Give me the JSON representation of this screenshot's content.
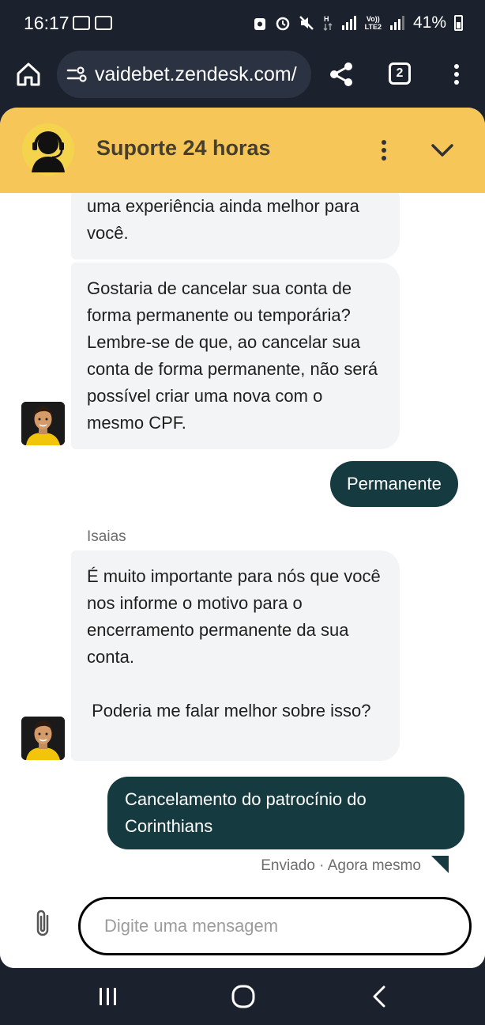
{
  "status_bar": {
    "time": "16:17",
    "notif_icons": [
      "ticket-icon",
      "ticket-icon"
    ],
    "right_icons": [
      "recycle-icon",
      "alarm-icon",
      "mute-icon",
      "hplus-data-icon",
      "signal-icon",
      "volte-lte2-icon",
      "signal-icon"
    ],
    "network_label_top": "Vo))",
    "network_label_bottom": "LTE2",
    "battery": "41%"
  },
  "browser": {
    "url": "vaidebet.zendesk.com/",
    "tab_count": "2",
    "icons": [
      "home-icon",
      "site-settings-icon",
      "share-icon",
      "tab-switcher-icon",
      "more-vert-icon"
    ]
  },
  "chat": {
    "header_title": "Suporte 24 horas",
    "header_color": "#f6c758",
    "agent_bubble_color": "#f3f4f6",
    "user_bubble_color": "#153a3f",
    "messages": [
      {
        "from": "agent",
        "text": "uma experiência ainda melhor para você."
      },
      {
        "from": "agent",
        "text": "Gostaria de cancelar sua conta de forma permanente ou temporária? Lembre-se de que, ao cancelar sua conta de forma permanente, não será possível criar uma nova com o mesmo CPF."
      },
      {
        "from": "user",
        "text": "Permanente"
      },
      {
        "from": "agent",
        "sender": "Isaias",
        "text": "É muito importante para nós que você nos informe o motivo para o encerramento permanente da sua conta.",
        "text2": " Poderia me falar melhor sobre isso?"
      },
      {
        "from": "user",
        "text": "Cancelamento do patrocínio do Corinthians",
        "status": "Enviado · Agora mesmo"
      }
    ],
    "composer_placeholder": "Digite uma mensagem"
  },
  "nav": {
    "icons": [
      "recent-apps-icon",
      "home-circle-icon",
      "back-icon"
    ]
  }
}
